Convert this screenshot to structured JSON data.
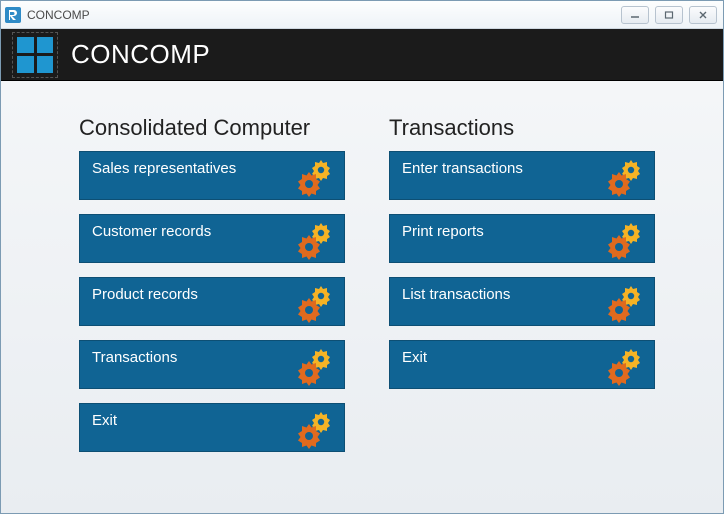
{
  "window": {
    "title": "CONCOMP"
  },
  "banner": {
    "app_name": "CONCOMP"
  },
  "columns": {
    "left": {
      "heading": "Consolidated Computer",
      "items": [
        "Sales representatives",
        "Customer records",
        "Product records",
        "Transactions",
        "Exit"
      ]
    },
    "right": {
      "heading": "Transactions",
      "items": [
        "Enter transactions",
        "Print reports",
        "List transactions",
        "Exit"
      ]
    }
  },
  "icons": {
    "app_icon": "app-r-icon",
    "gears": "gears-icon"
  },
  "colors": {
    "tile_bg": "#106494",
    "gear_orange": "#e06a1e",
    "gear_yellow": "#f5b325",
    "banner_bg": "#1b1b1b",
    "logo_blue": "#1f96d0"
  }
}
